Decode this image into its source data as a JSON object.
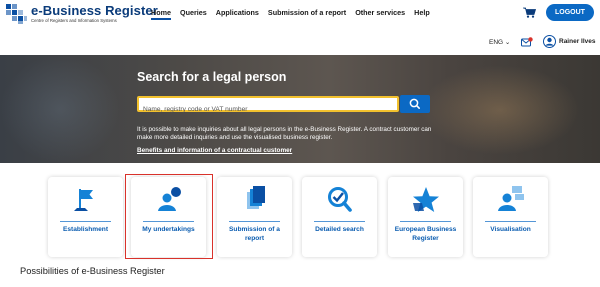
{
  "header": {
    "logo_title": "e-Business Register",
    "logo_subtitle": "Centre of Registers and Information Systems",
    "nav": [
      {
        "label": "Home",
        "active": true
      },
      {
        "label": "Queries"
      },
      {
        "label": "Applications"
      },
      {
        "label": "Submission of a report"
      },
      {
        "label": "Other services"
      },
      {
        "label": "Help"
      }
    ],
    "cart_icon": "shopping-cart-icon",
    "logout_label": "LOGOUT",
    "accent_color": "#0b69c4"
  },
  "subbar": {
    "language": "ENG ⌄",
    "user_name": "Rainer Ilves"
  },
  "hero": {
    "title": "Search for a legal person",
    "search_placeholder": "Name, registry code or VAT number",
    "info_text": "It is possible to make inquiries about all legal persons in the e-Business Register. A contract customer can make more detailed inquiries and use the visualised business register.",
    "link_text": "Benefits and information of a contractual customer"
  },
  "cards": [
    {
      "label": "Establishment",
      "icon": "flag-icon"
    },
    {
      "label": "My undertakings",
      "icon": "person-icon"
    },
    {
      "label": "Submission of a report",
      "icon": "documents-icon"
    },
    {
      "label": "Detailed search",
      "icon": "search-check-icon"
    },
    {
      "label": "European Business Register",
      "icon": "star-icon"
    },
    {
      "label": "Visualisation",
      "icon": "network-person-icon"
    }
  ],
  "highlight_color": "#d9322b",
  "section": {
    "title": "Possibilities of e-Business Register"
  }
}
